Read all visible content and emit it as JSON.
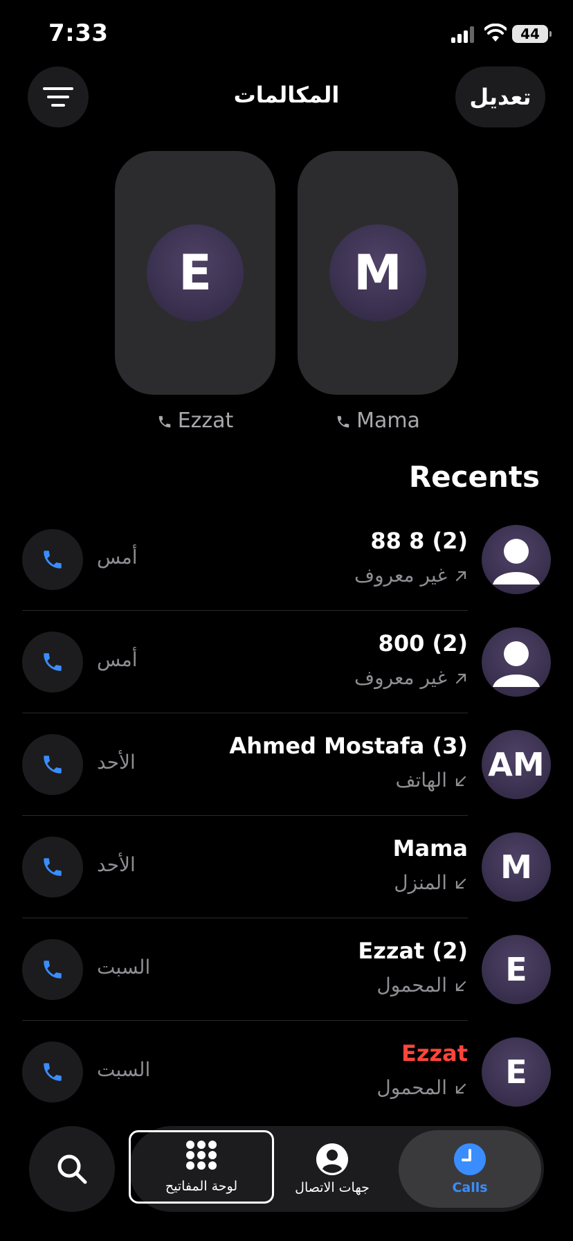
{
  "status_bar": {
    "time": "7:33",
    "battery": "44"
  },
  "header": {
    "title": "المكالمات",
    "edit_label": "تعديل",
    "menu_icon": "list-filter-icon"
  },
  "favorites": [
    {
      "initial": "E",
      "name": "Ezzat"
    },
    {
      "initial": "M",
      "name": "Mama"
    }
  ],
  "recents": {
    "title": "Recents",
    "items": [
      {
        "name": "88 8 (2)",
        "sub": "غير معروف",
        "direction": "outgoing",
        "day": "أمس",
        "avatar": "person",
        "missed": false
      },
      {
        "name": "800 (2)",
        "sub": "غير معروف",
        "direction": "outgoing",
        "day": "أمس",
        "avatar": "person",
        "missed": false
      },
      {
        "name": "Ahmed Mostafa (3)",
        "sub": "الهاتف",
        "direction": "incoming",
        "day": "الأحد",
        "avatar": "AM",
        "missed": false
      },
      {
        "name": "Mama",
        "sub": "المنزل",
        "direction": "incoming",
        "day": "الأحد",
        "avatar": "M",
        "missed": false
      },
      {
        "name": "Ezzat (2)",
        "sub": "المحمول",
        "direction": "incoming",
        "day": "السبت",
        "avatar": "E",
        "missed": false
      },
      {
        "name": "Ezzat",
        "sub": "المحمول",
        "direction": "incoming",
        "day": "السبت",
        "avatar": "E",
        "missed": true
      }
    ]
  },
  "tabs": {
    "keypad": "لوحة المفاتيح",
    "contacts": "جهات الاتصال",
    "calls": "Calls"
  },
  "colors": {
    "accent": "#3a8dff",
    "missed": "#ff453a",
    "background": "#000000",
    "surface": "#1c1c1e"
  }
}
